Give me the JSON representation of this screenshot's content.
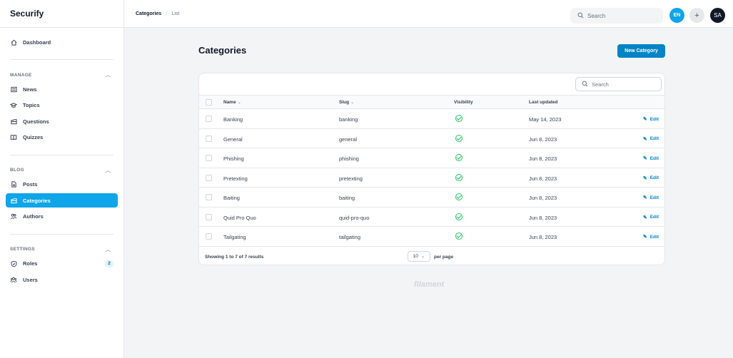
{
  "app": {
    "title": "Securify"
  },
  "sidebar": {
    "dashboard": {
      "label": "Dashboard",
      "icon": "home-icon"
    },
    "groups": [
      {
        "title": "MANAGE",
        "items": [
          {
            "label": "News",
            "icon": "newspaper-icon"
          },
          {
            "label": "Topics",
            "icon": "graduation-cap-icon"
          },
          {
            "label": "Questions",
            "icon": "folder-icon"
          },
          {
            "label": "Quizzes",
            "icon": "book-open-icon"
          }
        ]
      },
      {
        "title": "BLOG",
        "items": [
          {
            "label": "Posts",
            "icon": "document-icon"
          },
          {
            "label": "Categories",
            "icon": "folder-icon",
            "active": true
          },
          {
            "label": "Authors",
            "icon": "user-group-icon"
          }
        ]
      },
      {
        "title": "SETTINGS",
        "items": [
          {
            "label": "Roles",
            "icon": "shield-check-icon",
            "badge": "2"
          },
          {
            "label": "Users",
            "icon": "users-icon"
          }
        ]
      }
    ]
  },
  "topbar": {
    "breadcrumb": [
      "Categories",
      "List"
    ],
    "search_placeholder": "Search",
    "locale_badge": "EN",
    "user_initials": "SA"
  },
  "main": {
    "title": "Categories",
    "new_button": "New Category",
    "table": {
      "search_placeholder": "Search",
      "columns": [
        "Name",
        "Slug",
        "Visibility",
        "Last updated"
      ],
      "rows": [
        {
          "name": "Banking",
          "slug": "banking",
          "visible": true,
          "updated": "May 14, 2023",
          "action": "Edit"
        },
        {
          "name": "General",
          "slug": "general",
          "visible": true,
          "updated": "Jun 8, 2023",
          "action": "Edit"
        },
        {
          "name": "Phishing",
          "slug": "phishing",
          "visible": true,
          "updated": "Jun 8, 2023",
          "action": "Edit"
        },
        {
          "name": "Pretexting",
          "slug": "pretexting",
          "visible": true,
          "updated": "Jun 8, 2023",
          "action": "Edit"
        },
        {
          "name": "Baiting",
          "slug": "baiting",
          "visible": true,
          "updated": "Jun 8, 2023",
          "action": "Edit"
        },
        {
          "name": "Quid Pro Quo",
          "slug": "quid-pro-quo",
          "visible": true,
          "updated": "Jun 8, 2023",
          "action": "Edit"
        },
        {
          "name": "Tailgating",
          "slug": "tailgating",
          "visible": true,
          "updated": "Jun 8, 2023",
          "action": "Edit"
        }
      ],
      "footer": {
        "showing": "Showing 1 to 7 of 7 results",
        "per_page_value": "10",
        "per_page_label": "per page"
      }
    },
    "footer_brand": "filament"
  },
  "colors": {
    "primary": "#0284c7",
    "active_nav": "#0ea5e9",
    "success": "#22c55e"
  }
}
